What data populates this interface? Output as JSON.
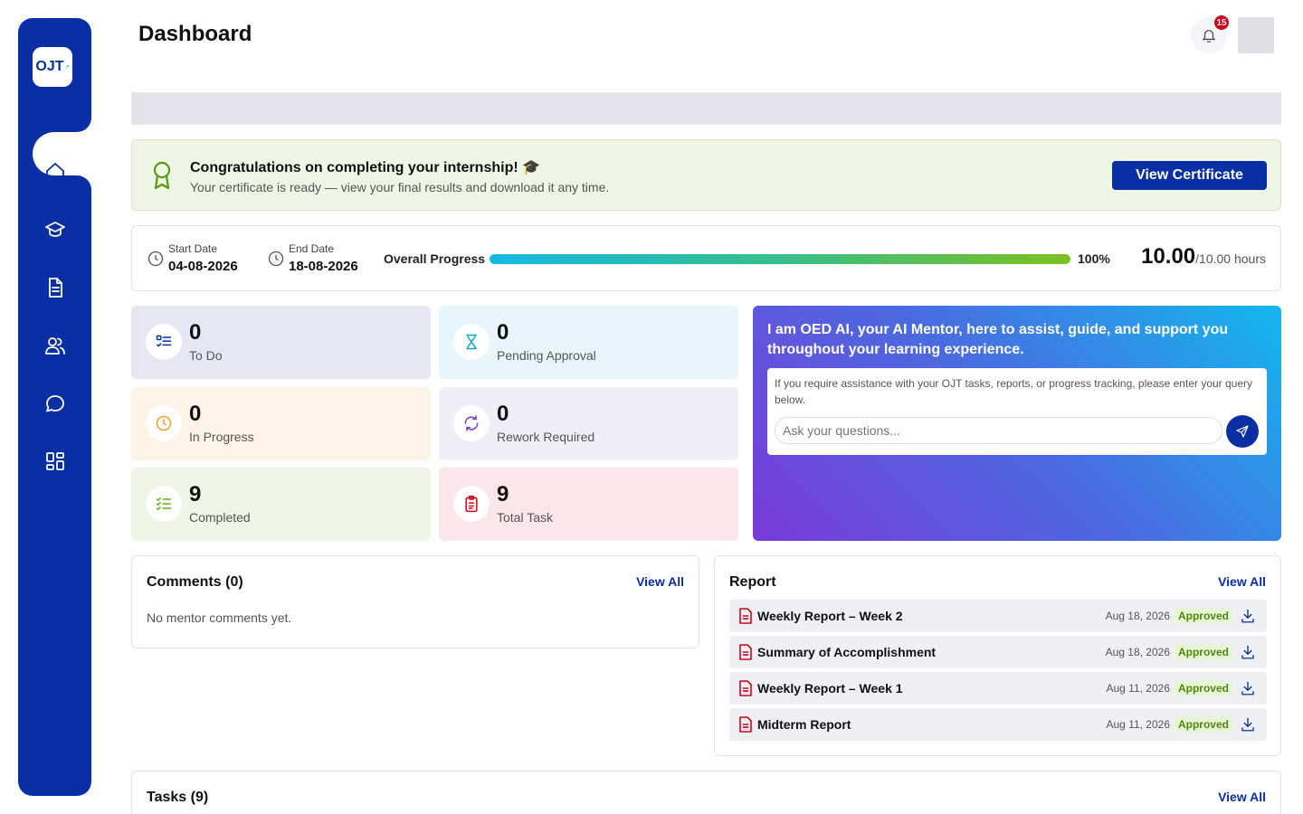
{
  "app": {
    "logo_text": "OJT",
    "logo_sub": "↗"
  },
  "header": {
    "title": "Dashboard",
    "notification_count": "15"
  },
  "sidebar": {
    "items": [
      {
        "icon": "home-icon",
        "active": true
      },
      {
        "icon": "graduation-cap-icon"
      },
      {
        "icon": "document-icon"
      },
      {
        "icon": "users-icon"
      },
      {
        "icon": "chat-icon"
      },
      {
        "icon": "grid-icon"
      }
    ]
  },
  "congrats": {
    "heading": "Congratulations on completing your internship! 🎓",
    "text": "Your certificate is ready — view your final results and download it any time.",
    "button": "View Certificate"
  },
  "progress": {
    "start_label": "Start Date",
    "start_value": "04-08-2026",
    "end_label": "End Date",
    "end_value": "18-08-2026",
    "overall_label": "Overall Progress",
    "percent": 100,
    "percent_text": "100%",
    "hours_done": "10.00",
    "hours_total": "/10.00 hours"
  },
  "stats": [
    {
      "count": "0",
      "label": "To Do",
      "icon": "checklist-icon",
      "bg": "#e5e8f4",
      "color": "#0a2fa5"
    },
    {
      "count": "0",
      "label": "Pending Approval",
      "icon": "hourglass-icon",
      "bg": "#e6f6fc",
      "color": "#13a6cf"
    },
    {
      "count": "0",
      "label": "In Progress",
      "icon": "clock-icon",
      "bg": "#fdf4e6",
      "color": "#f0a020"
    },
    {
      "count": "0",
      "label": "Rework Required",
      "icon": "refresh-icon",
      "bg": "#f1eef8",
      "color": "#7b3ad8"
    },
    {
      "count": "9",
      "label": "Completed",
      "icon": "check-list-icon",
      "bg": "#eef6e6",
      "color": "#6aaa1a"
    },
    {
      "count": "9",
      "label": "Total Task",
      "icon": "clipboard-icon",
      "bg": "#fbe6ea",
      "color": "#d0021b"
    }
  ],
  "ai": {
    "heading": "I am OED AI, your AI Mentor, here to assist, guide, and support you throughout your learning experience.",
    "description": "If you require assistance with your OJT tasks, reports, or progress tracking, please enter your query below.",
    "placeholder": "Ask your questions..."
  },
  "comments": {
    "title": "Comments (0)",
    "view_all": "View All",
    "empty": "No mentor comments yet."
  },
  "report": {
    "title": "Report",
    "view_all": "View All",
    "rows": [
      {
        "name": "Weekly Report – Week 2",
        "date": "Aug 18, 2026",
        "status": "Approved"
      },
      {
        "name": "Summary of Accomplishment",
        "date": "Aug 18, 2026",
        "status": "Approved"
      },
      {
        "name": "Weekly Report – Week 1",
        "date": "Aug 11, 2026",
        "status": "Approved"
      },
      {
        "name": "Midterm Report",
        "date": "Aug 11, 2026",
        "status": "Approved"
      }
    ]
  },
  "tasks": {
    "title": "Tasks (9)",
    "view_all": "View All"
  }
}
